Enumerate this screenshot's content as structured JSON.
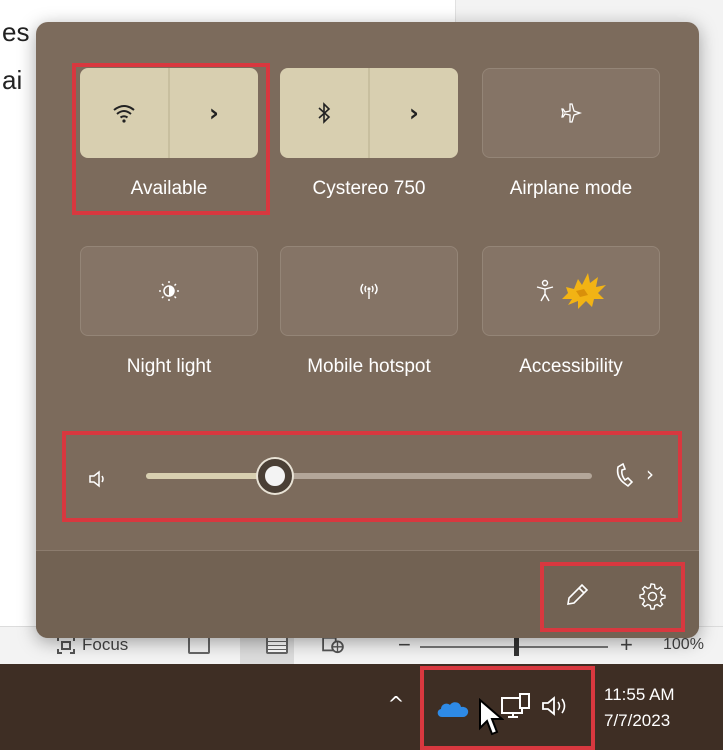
{
  "document": {
    "line1": "es of pictures, and",
    "line2": "ai"
  },
  "word_status_bar": {
    "focus_label": "Focus",
    "zoom_minus": "−",
    "zoom_plus": "+",
    "zoom_level": "100%",
    "zoom_fraction": 0.5
  },
  "quick_settings": {
    "tiles": [
      {
        "label": "Available",
        "icon": "wifi-icon",
        "state": "on",
        "has_arrow": true,
        "arrow": "›"
      },
      {
        "label": "Cystereo 750",
        "icon": "bluetooth-icon",
        "state": "on",
        "has_arrow": true,
        "arrow": "›"
      },
      {
        "label": "Airplane mode",
        "icon": "airplane-icon",
        "state": "off",
        "has_arrow": false
      },
      {
        "label": "Night light",
        "icon": "night-light-icon",
        "state": "off",
        "has_arrow": false
      },
      {
        "label": "Mobile hotspot",
        "icon": "mobile-hotspot-icon",
        "state": "off",
        "has_arrow": false
      },
      {
        "label": "Accessibility",
        "icon": "accessibility-icon",
        "state": "off",
        "has_arrow": false
      }
    ],
    "volume": {
      "level": 0.29,
      "chevron": "›"
    },
    "footer": {
      "edit_icon": "pencil-icon",
      "settings_icon": "gear-icon"
    }
  },
  "taskbar": {
    "chevron": "^",
    "clock_time": "11:55 AM",
    "clock_date": "7/7/2023"
  },
  "colors": {
    "panel_bg": "#7c6b5c",
    "tile_on": "#d8cfb0",
    "tile_off": "#857466",
    "highlight_red": "#d8383f",
    "taskbar": "#3e2e24",
    "onedrive_blue": "#2e8ae6"
  }
}
